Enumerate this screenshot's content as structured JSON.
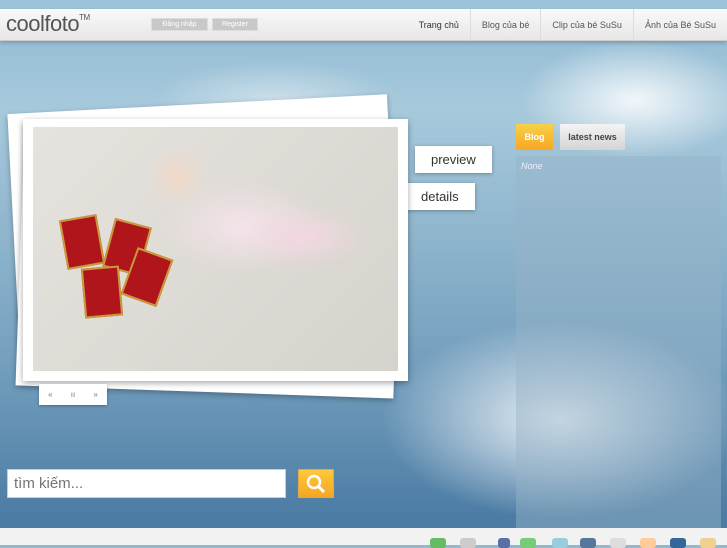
{
  "header": {
    "logo": "coolfoto",
    "logo_tm": "TM",
    "login": "Đăng nhập",
    "register": "Register",
    "nav": [
      "Trang chủ",
      "Blog của bé",
      "Clip của bé SuSu",
      "Ảnh của Bé SuSu"
    ]
  },
  "gallery": {
    "preview": "preview",
    "details": "details",
    "controls": {
      "prev": "«",
      "pause": "ıı",
      "next": "»"
    }
  },
  "sidebar": {
    "tabs": [
      "Blog",
      "latest news"
    ],
    "content": "None"
  },
  "search": {
    "placeholder": "tìm kiếm..."
  },
  "colors": {
    "accent": "#f7b733",
    "header": "#f0f0f0"
  }
}
